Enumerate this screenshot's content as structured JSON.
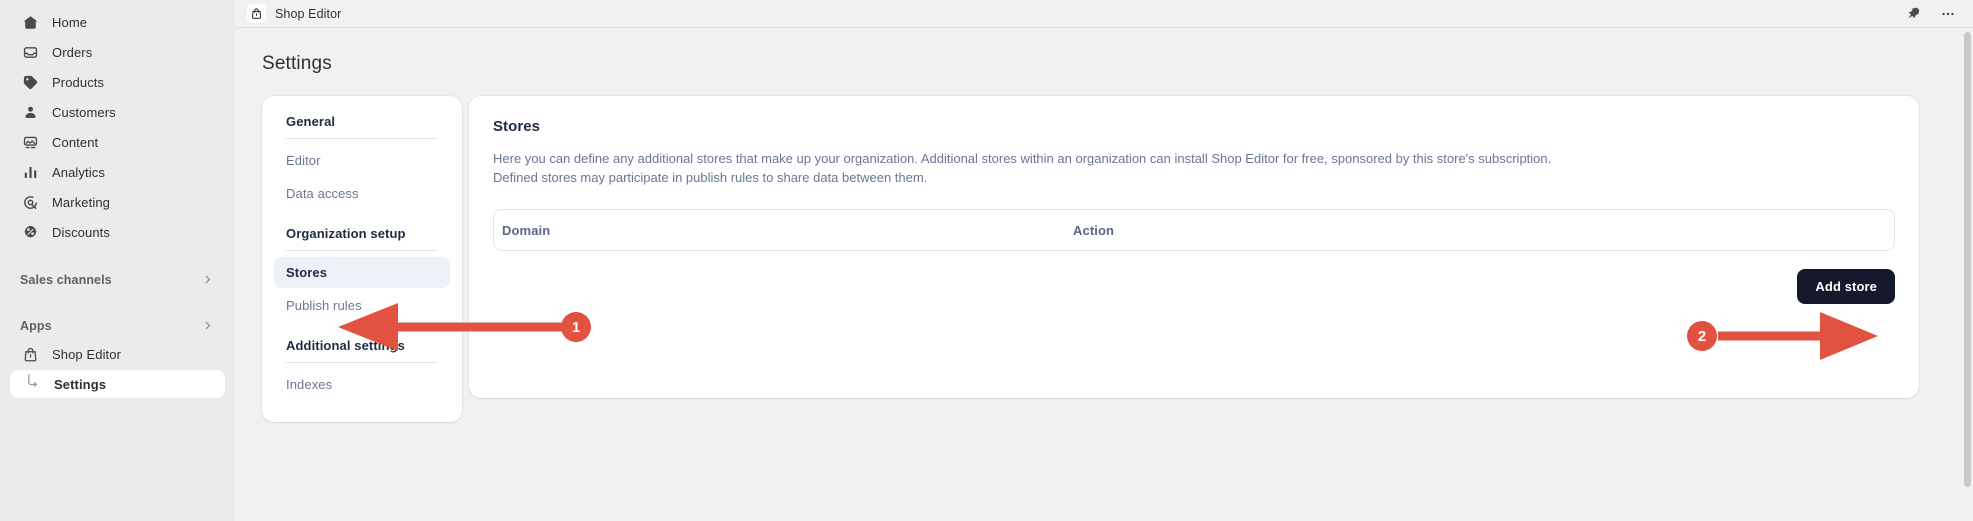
{
  "sidebar": {
    "items": [
      {
        "label": "Home",
        "icon": "home-icon"
      },
      {
        "label": "Orders",
        "icon": "orders-icon"
      },
      {
        "label": "Products",
        "icon": "products-tag-icon"
      },
      {
        "label": "Customers",
        "icon": "customers-person-icon"
      },
      {
        "label": "Content",
        "icon": "content-image-icon"
      },
      {
        "label": "Analytics",
        "icon": "analytics-bars-icon"
      },
      {
        "label": "Marketing",
        "icon": "marketing-target-icon"
      },
      {
        "label": "Discounts",
        "icon": "discounts-percent-icon"
      }
    ],
    "groups": [
      {
        "label": "Sales channels",
        "icon": "chevron-right-icon"
      },
      {
        "label": "Apps",
        "icon": "chevron-right-icon"
      }
    ],
    "app": {
      "label": "Shop Editor",
      "icon": "shop-bag-icon"
    },
    "app_sub": {
      "label": "Settings",
      "icon": "branch-arrow-icon",
      "active": true
    }
  },
  "topbar": {
    "app_title": "Shop Editor",
    "app_icon": "shop-bag-icon",
    "pin_icon": "pin-icon",
    "more_icon": "ellipsis-horizontal-icon"
  },
  "page": {
    "title": "Settings"
  },
  "settings_nav": {
    "sections": [
      {
        "title": "General",
        "items": [
          {
            "label": "Editor",
            "active": false
          },
          {
            "label": "Data access",
            "active": false
          }
        ]
      },
      {
        "title": "Organization setup",
        "items": [
          {
            "label": "Stores",
            "active": true
          },
          {
            "label": "Publish rules",
            "active": false
          }
        ]
      },
      {
        "title": "Additional settings",
        "items": [
          {
            "label": "Indexes",
            "active": false
          }
        ]
      }
    ]
  },
  "stores_card": {
    "title": "Stores",
    "description": "Here you can define any additional stores that make up your organization. Additional stores within an organization can install Shop Editor for free, sponsored by this store's subscription. Defined stores may participate in publish rules to share data between them.",
    "table": {
      "columns": [
        "Domain",
        "Action"
      ],
      "rows": []
    },
    "add_button": "Add store"
  },
  "annotations": {
    "accent_color": "#e15241",
    "markers": [
      {
        "number": "1",
        "target": "stores-nav-item",
        "direction": "left"
      },
      {
        "number": "2",
        "target": "add-store-button",
        "direction": "right"
      }
    ]
  }
}
